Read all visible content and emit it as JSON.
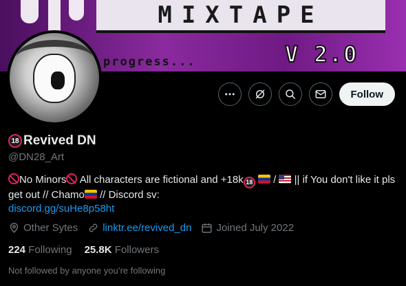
{
  "banner": {
    "title": "MIXTAPE",
    "version": "V 2.0",
    "progress_text": "progress..."
  },
  "profile": {
    "display_name": "Revived DN",
    "name_badge": "18",
    "handle": "@DN28_Art"
  },
  "actions": {
    "follow_label": "Follow"
  },
  "bio": {
    "part1": "No Minors",
    "part2": " All characters are fictional and +18k",
    "part3": " / ",
    "part4": " || if You don't like it pls get out // Chamo",
    "part5": " //  Discord sv: ",
    "badge": "18",
    "link": "discord.gg/suHe8p58ht"
  },
  "meta": {
    "location": "Other Sytes",
    "website": "linktr.ee/revived_dn",
    "joined": "Joined July 2022"
  },
  "counts": {
    "following_num": "224",
    "following_label": "Following",
    "followers_num": "25.8K",
    "followers_label": "Followers"
  },
  "mutual_text": "Not followed by anyone you’re following",
  "colors": {
    "accent": "#1d9bf0",
    "muted": "#71767b",
    "background": "#000000"
  }
}
